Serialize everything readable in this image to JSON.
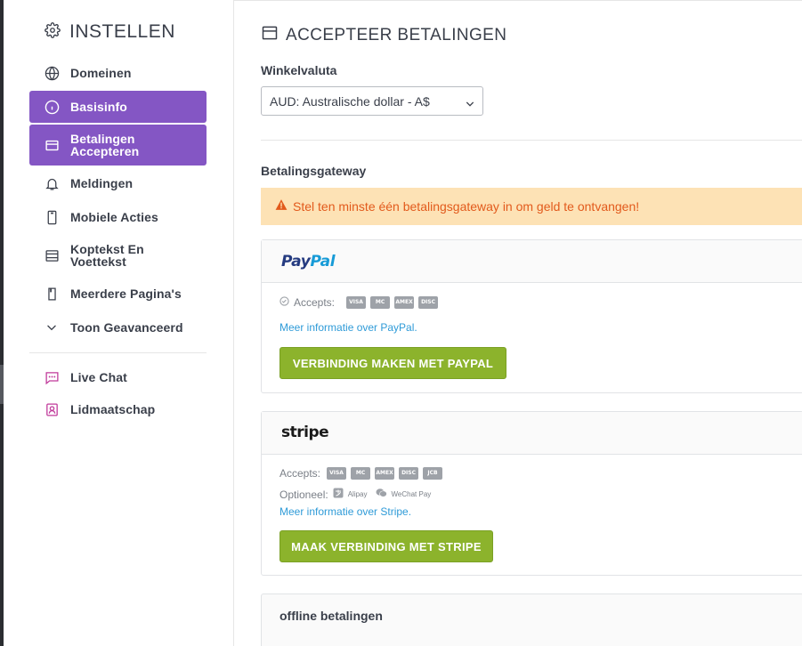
{
  "sidebar": {
    "title": "INSTELLEN",
    "items": [
      {
        "label": "Domeinen"
      },
      {
        "label": "Basisinfo"
      },
      {
        "label": "Betalingen Accepteren"
      },
      {
        "label": "Meldingen"
      },
      {
        "label": "Mobiele Acties"
      },
      {
        "label": "Koptekst En Voettekst"
      },
      {
        "label": "Meerdere Pagina's"
      },
      {
        "label": "Toon Geavanceerd"
      }
    ],
    "extra_items": [
      {
        "label": "Live Chat"
      },
      {
        "label": "Lidmaatschap"
      }
    ],
    "accent_color": "#8456c4"
  },
  "main": {
    "title": "ACCEPTEER BETALINGEN",
    "currency_label": "Winkelvaluta",
    "currency_value": "AUD: Australische dollar - A$",
    "gateway_label": "Betalingsgateway",
    "alert": "Stel ten minste één betalingsgateway in om geld te ontvangen!",
    "paypal": {
      "logo_a": "Pay",
      "logo_b": "Pal",
      "accepts": "Accepts:",
      "cards": [
        "VISA",
        "MC",
        "AMEX",
        "DISC"
      ],
      "link": "Meer informatie over PayPal.",
      "button": "VERBINDING MAKEN MET PAYPAL"
    },
    "stripe": {
      "logo": "stripe",
      "accepts": "Accepts:",
      "cards": [
        "VISA",
        "MC",
        "AMEX",
        "DISC",
        "JCB"
      ],
      "optional": "Optioneel:",
      "alipay": "Alipay",
      "wechat": "WeChat Pay",
      "link": "Meer informatie over Stripe.",
      "button": "MAAK VERBINDING MET STRIPE"
    },
    "offline": {
      "title": "offline betalingen"
    },
    "button_color": "#8cb32c",
    "alert_color": "#e25a1c"
  }
}
